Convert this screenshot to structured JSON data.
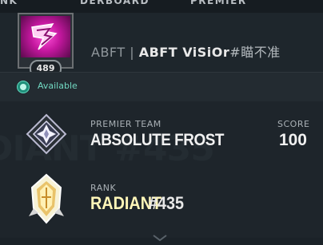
{
  "nav": {
    "left": "NK",
    "middle": "DERBOARD",
    "right": "PREMIER"
  },
  "player": {
    "level": "489",
    "prefix": "ABFT",
    "separator": "|",
    "name": "ABFT ViSiOr",
    "tag": "#瞄不准"
  },
  "status": {
    "text": "Available",
    "color": "#71d8c2"
  },
  "premier": {
    "label": "PREMIER TEAM",
    "team_name": "ABSOLUTE FROST",
    "score_label": "SCORE",
    "score_value": "100",
    "watermark": "DIANT #435"
  },
  "rank": {
    "label": "RANK",
    "name": "RADIANT",
    "number": "#435",
    "color": "#fff6b8"
  },
  "icons": {
    "player_card": "player-card-icon",
    "premier": "premier-team-emblem-icon",
    "rank": "radiant-rank-icon",
    "status": "status-dot-icon"
  }
}
